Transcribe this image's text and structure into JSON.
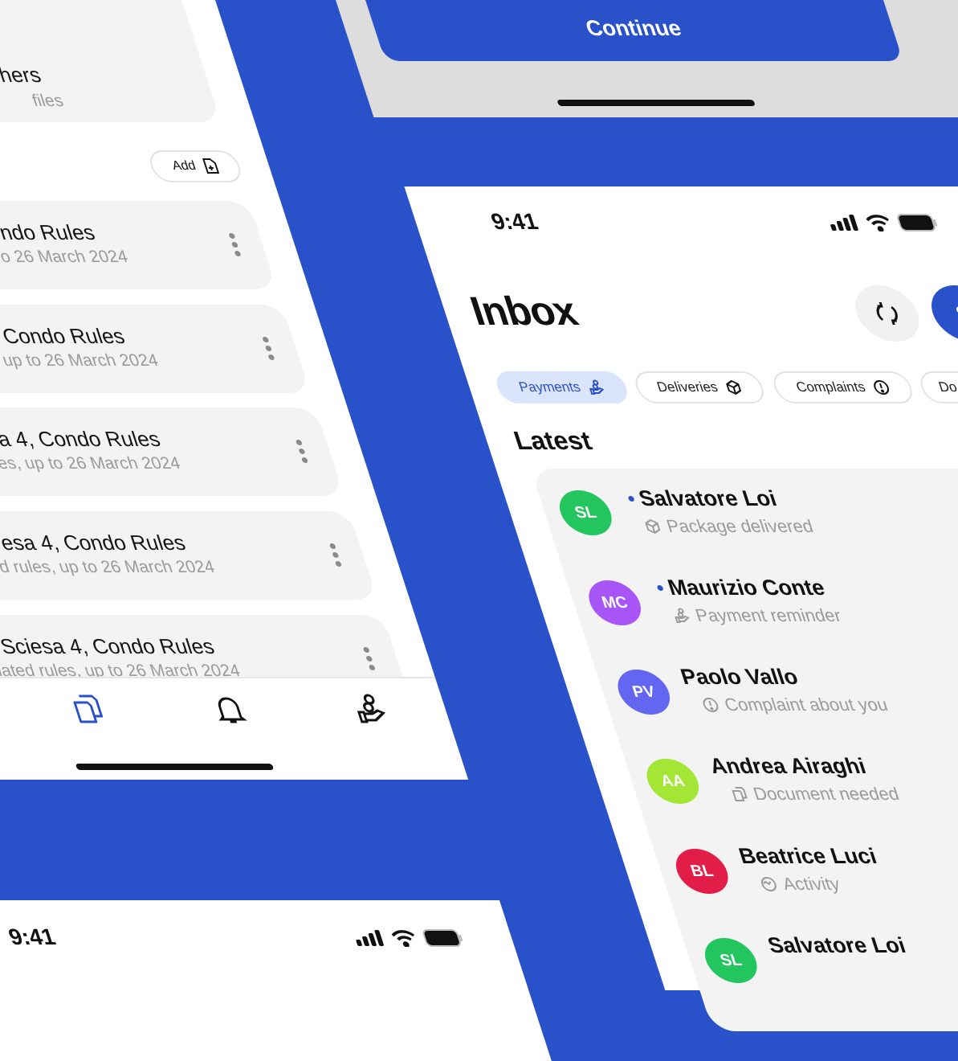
{
  "colors": {
    "brand": "#2951c9",
    "chip_active_bg": "#dbe4fd",
    "card_bg": "#f3f3f3"
  },
  "left_phone": {
    "top_card": {
      "title": "hers",
      "subtitle": "files"
    },
    "add_button": {
      "label": "Add",
      "icon": "file-plus-icon"
    },
    "documents": [
      {
        "title": "ndo Rules",
        "subtitle": "o 26 March 2024"
      },
      {
        "title": "Condo Rules",
        "subtitle": "up to 26 March 2024"
      },
      {
        "title": "a 4, Condo Rules",
        "subtitle": "es, up to 26 March 2024"
      },
      {
        "title": "esa 4, Condo Rules",
        "subtitle": "d rules, up to 26 March 2024"
      },
      {
        "title": "Sciesa 4, Condo Rules",
        "subtitle": "lated rules, up to 26 March 2024"
      }
    ],
    "tab_bar": [
      {
        "icon": "documents-icon",
        "active": true
      },
      {
        "icon": "bell-icon",
        "active": false
      },
      {
        "icon": "payments-icon",
        "active": false
      }
    ]
  },
  "bottom_phone": {
    "status_time": "9:41"
  },
  "top_sheet": {
    "continue_label": "Continue"
  },
  "inbox_phone": {
    "status_time": "9:41",
    "title": "Inbox",
    "avatar_initial": "S",
    "filters": [
      {
        "label": "Payments",
        "icon": "payments-icon",
        "active": true
      },
      {
        "label": "Deliveries",
        "icon": "box-icon",
        "active": false
      },
      {
        "label": "Complaints",
        "icon": "alert-circle-icon",
        "active": false
      },
      {
        "label": "Do",
        "icon": "",
        "active": false
      }
    ],
    "section_title": "Latest",
    "messages": [
      {
        "initials": "SL",
        "color": "#22c55e",
        "name": "Salvatore Loi",
        "unread": true,
        "subtitle": "Package delivered",
        "icon": "box-icon"
      },
      {
        "initials": "MC",
        "color": "#a855f7",
        "name": "Maurizio Conte",
        "unread": true,
        "subtitle": "Payment reminder",
        "icon": "payments-icon"
      },
      {
        "initials": "PV",
        "color": "#6366f1",
        "name": "Paolo Vallo",
        "unread": false,
        "subtitle": "Complaint about you",
        "icon": "alert-circle-icon"
      },
      {
        "initials": "AA",
        "color": "#a3e635",
        "name": "Andrea Airaghi",
        "unread": false,
        "subtitle": "Document needed",
        "icon": "documents-icon"
      },
      {
        "initials": "BL",
        "color": "#e11d48",
        "name": "Beatrice Luci",
        "unread": false,
        "subtitle": "Activity",
        "icon": "activity-icon"
      },
      {
        "initials": "SL",
        "color": "#22c55e",
        "name": "Salvatore Loi",
        "unread": false,
        "subtitle": "",
        "icon": ""
      }
    ]
  }
}
